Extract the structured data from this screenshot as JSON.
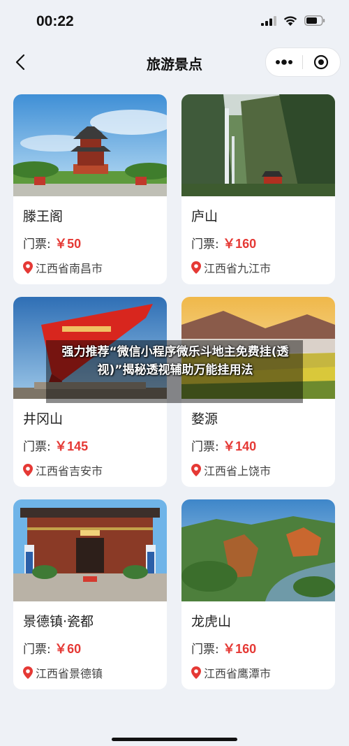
{
  "status_bar": {
    "time": "00:22"
  },
  "nav": {
    "title": "旅游景点"
  },
  "spots": [
    {
      "name": "滕王阁",
      "price_label": "门票:",
      "price": "￥50",
      "location": "江西省南昌市"
    },
    {
      "name": "庐山",
      "price_label": "门票:",
      "price": "￥160",
      "location": "江西省九江市"
    },
    {
      "name": "井冈山",
      "price_label": "门票:",
      "price": "￥145",
      "location": "江西省吉安市"
    },
    {
      "name": "婺源",
      "price_label": "门票:",
      "price": "￥140",
      "location": "江西省上饶市"
    },
    {
      "name": "景德镇·瓷都",
      "price_label": "门票:",
      "price": "￥60",
      "location": "江西省景德镇"
    },
    {
      "name": "龙虎山",
      "price_label": "门票:",
      "price": "￥160",
      "location": "江西省鹰潭市"
    }
  ],
  "overlay": {
    "text": "强力推荐“微信小程序微乐斗地主免费挂(透视)”揭秘透视辅助万能挂用法"
  },
  "colors": {
    "price": "#e53935",
    "background": "#eef1f6",
    "pin": "#e53935"
  }
}
